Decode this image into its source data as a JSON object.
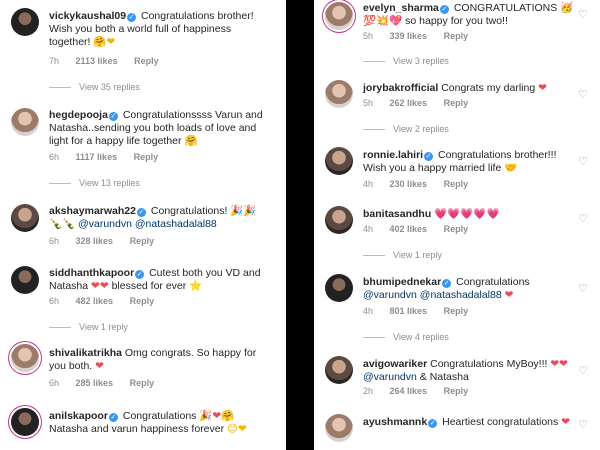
{
  "left": {
    "comments": [
      {
        "user": "vickykaushal09",
        "text": "Congratulations brother! Wish you both a world full of happiness together!",
        "emoji": "🤗❤",
        "time": "7h",
        "likes": "2113 likes",
        "reply": "Reply",
        "view_replies": "View 35 replies"
      },
      {
        "user": "hegdepooja",
        "text": "Congratulationssss Varun and Natasha..sending you both loads of love and light for a happy life together",
        "emoji": "🤗",
        "time": "6h",
        "likes": "1117 likes",
        "reply": "Reply",
        "view_replies": "View 13 replies"
      },
      {
        "user": "akshaymarwah22",
        "text": "Congratulations!",
        "emoji": "🎉🎉🍾🍾",
        "mention1": "@varundvn",
        "mention2": "@natashadalal88",
        "time": "6h",
        "likes": "328 likes",
        "reply": "Reply"
      },
      {
        "user": "siddhanthkapoor",
        "text": "Cutest both you VD and Natasha",
        "text2": "blessed for ever",
        "emoji": "❤❤",
        "emoji2": "⭐",
        "time": "6h",
        "likes": "482 likes",
        "reply": "Reply",
        "view_replies": "View 1 reply"
      },
      {
        "user": "shivalikatrikha",
        "text": "Omg congrats. So happy for you both.",
        "emoji": "❤",
        "time": "6h",
        "likes": "285 likes",
        "reply": "Reply"
      },
      {
        "user": "anilskapoor",
        "text": "Congratulations",
        "emoji": "🎉❤🤗",
        "text2": "Natasha and varun happiness forever",
        "emoji2": "😊❤"
      }
    ]
  },
  "right": {
    "comments": [
      {
        "user": "evelyn_sharma",
        "text": "CONGRATULATIONS",
        "emoji": "🥳",
        "emoji2": "💯💥💖",
        "text2": "so happy for you two!!",
        "time": "5h",
        "likes": "339 likes",
        "reply": "Reply",
        "view_replies": "View 3 replies"
      },
      {
        "user": "jorybakrofficial",
        "text": "Congrats my darling",
        "emoji": "❤",
        "time": "5h",
        "likes": "262 likes",
        "reply": "Reply",
        "view_replies": "View 2 replies"
      },
      {
        "user": "ronnie.lahiri",
        "text": "Congratulations brother!!! Wish you a happy married life",
        "emoji": "🤝",
        "time": "4h",
        "likes": "230 likes",
        "reply": "Reply"
      },
      {
        "user": "banitasandhu",
        "emoji": "💗💗💗💗💗",
        "time": "4h",
        "likes": "402 likes",
        "reply": "Reply",
        "view_replies": "View 1 reply"
      },
      {
        "user": "bhumipednekar",
        "text": "Congratulations",
        "mention1": "@varundvn",
        "mention2": "@natashadalal88",
        "emoji": "❤",
        "time": "4h",
        "likes": "801 likes",
        "reply": "Reply",
        "view_replies": "View 4 replies"
      },
      {
        "user": "avigowariker",
        "text": "Congratulations MyBoy!!!",
        "emoji": "❤❤",
        "mention1": "@varundvn",
        "text2": "& Natasha",
        "time": "2h",
        "likes": "264 likes",
        "reply": "Reply"
      },
      {
        "user": "ayushmannk",
        "text": "Heartiest congratulations",
        "emoji": "❤"
      }
    ]
  },
  "icons": {
    "verified": "verified-badge-icon",
    "like": "heart-outline-icon"
  },
  "colors": {
    "verified": "#3897f0",
    "mention": "#003569",
    "meta": "#8e8e8e",
    "heart": "#ed4956"
  }
}
